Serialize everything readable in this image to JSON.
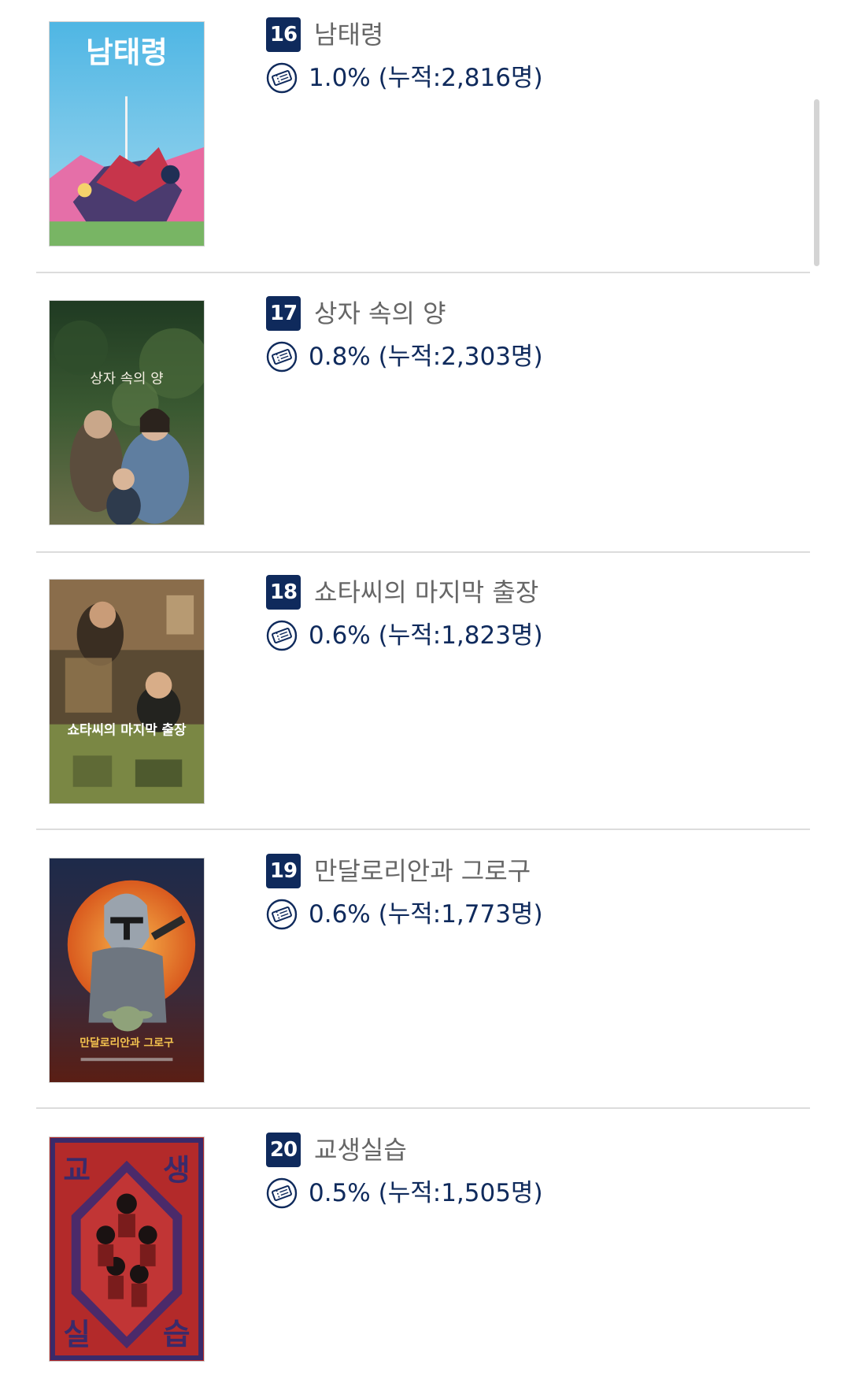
{
  "colors": {
    "badge_bg": "#0f2a5c",
    "stat_text": "#0f2a5c",
    "title_text": "#666666",
    "divider": "#dcdcdc"
  },
  "movies": [
    {
      "rank": "16",
      "title": "남태령",
      "stat": "1.0% (누적:2,816명)",
      "icon": "ticket-icon",
      "poster_text": "남태령",
      "poster_theme": "sky-blue"
    },
    {
      "rank": "17",
      "title": "상자 속의 양",
      "stat": "0.8% (누적:2,303명)",
      "icon": "ticket-icon",
      "poster_text": "상자 속의 양",
      "poster_theme": "forest-green"
    },
    {
      "rank": "18",
      "title": "쇼타씨의 마지막 출장",
      "stat": "0.6% (누적:1,823명)",
      "icon": "ticket-icon",
      "poster_text": "쇼타씨의 마지막 출장",
      "poster_theme": "olive-brown"
    },
    {
      "rank": "19",
      "title": "만달로리안과 그로구",
      "stat": "0.6% (누적:1,773명)",
      "icon": "ticket-icon",
      "poster_text": "만달로리안과 그로구",
      "poster_theme": "orange-navy"
    },
    {
      "rank": "20",
      "title": "교생실습",
      "stat": "0.5% (누적:1,505명)",
      "icon": "ticket-icon",
      "poster_text_letters": [
        "교",
        "생",
        "실",
        "습"
      ],
      "poster_theme": "red-purple"
    }
  ]
}
